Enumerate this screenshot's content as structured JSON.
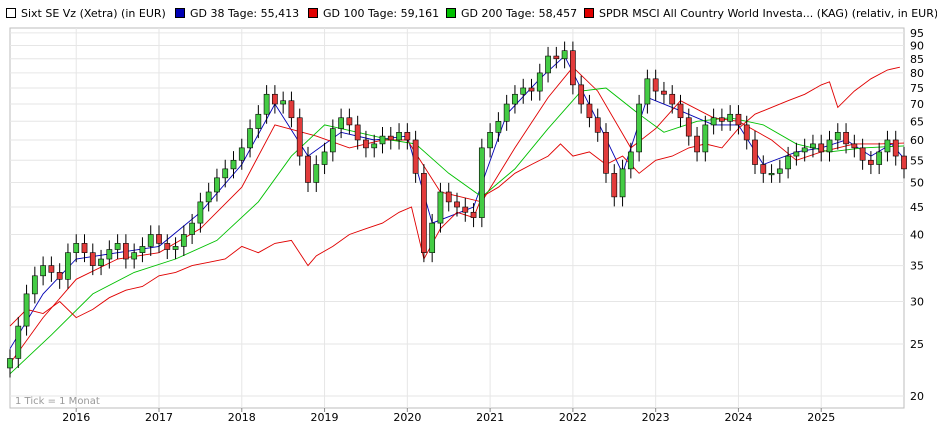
{
  "colors": {
    "ma38": "#0000b4",
    "ma100": "#e00000",
    "ma200": "#00c000",
    "benchmark": "#e00000",
    "candle_up": "#44cc44",
    "candle_down": "#e23b3b",
    "grid": "#e6e6e6"
  },
  "legend": [
    {
      "label": "Sixt SE Vz (Xetra) (in EUR)",
      "color": "#ffffff"
    },
    {
      "label": "GD 38 Tage: 55,413",
      "color": "#0000b4"
    },
    {
      "label": "GD 100 Tage: 59,161",
      "color": "#e00000"
    },
    {
      "label": "GD 200 Tage: 58,457",
      "color": "#00c000"
    },
    {
      "label": "SPDR MSCI All Country World Investa... (KAG) (relativ, in EUR)",
      "color": "#e00000"
    }
  ],
  "footnote": "1 Tick = 1 Monat",
  "chart_data": {
    "type": "candlestick",
    "y_scale": "log",
    "ylim": [
      19,
      97
    ],
    "y_ticks": [
      20,
      25,
      30,
      35,
      40,
      45,
      50,
      55,
      60,
      65,
      70,
      75,
      80,
      85,
      90,
      95
    ],
    "x_ticks": [
      "2016",
      "2017",
      "2018",
      "2019",
      "2020",
      "2021",
      "2022",
      "2023",
      "2024",
      "2025"
    ],
    "x_range": [
      "2015.2",
      "2026.0"
    ],
    "grid": true,
    "series": [
      {
        "name": "Sixt SE Vz (Xetra) (in EUR)",
        "kind": "close",
        "points": [
          [
            2015.2,
            23.5
          ],
          [
            2015.3,
            27
          ],
          [
            2015.4,
            31
          ],
          [
            2015.5,
            33.5
          ],
          [
            2015.6,
            35
          ],
          [
            2015.7,
            34
          ],
          [
            2015.8,
            33
          ],
          [
            2015.9,
            37
          ],
          [
            2016.0,
            38.5
          ],
          [
            2016.1,
            37
          ],
          [
            2016.2,
            35
          ],
          [
            2016.3,
            36
          ],
          [
            2016.4,
            37.5
          ],
          [
            2016.5,
            38.5
          ],
          [
            2016.6,
            36
          ],
          [
            2016.7,
            37
          ],
          [
            2016.8,
            38
          ],
          [
            2016.9,
            40
          ],
          [
            2017.0,
            38.5
          ],
          [
            2017.1,
            37.5
          ],
          [
            2017.2,
            38
          ],
          [
            2017.3,
            40
          ],
          [
            2017.4,
            42
          ],
          [
            2017.5,
            46
          ],
          [
            2017.6,
            48
          ],
          [
            2017.7,
            51
          ],
          [
            2017.8,
            53
          ],
          [
            2017.9,
            55
          ],
          [
            2018.0,
            58
          ],
          [
            2018.1,
            63
          ],
          [
            2018.2,
            67
          ],
          [
            2018.3,
            73
          ],
          [
            2018.4,
            70
          ],
          [
            2018.5,
            71
          ],
          [
            2018.6,
            66
          ],
          [
            2018.7,
            56
          ],
          [
            2018.8,
            50
          ],
          [
            2018.9,
            54
          ],
          [
            2019.0,
            57
          ],
          [
            2019.1,
            63
          ],
          [
            2019.2,
            66
          ],
          [
            2019.3,
            64
          ],
          [
            2019.4,
            60
          ],
          [
            2019.5,
            58
          ],
          [
            2019.6,
            59
          ],
          [
            2019.7,
            61
          ],
          [
            2019.8,
            60
          ],
          [
            2019.9,
            62
          ],
          [
            2020.0,
            60
          ],
          [
            2020.1,
            52
          ],
          [
            2020.2,
            37
          ],
          [
            2020.3,
            42
          ],
          [
            2020.4,
            48
          ],
          [
            2020.5,
            46
          ],
          [
            2020.6,
            45
          ],
          [
            2020.7,
            44
          ],
          [
            2020.8,
            43
          ],
          [
            2020.9,
            58
          ],
          [
            2021.0,
            62
          ],
          [
            2021.1,
            65
          ],
          [
            2021.2,
            70
          ],
          [
            2021.3,
            73
          ],
          [
            2021.4,
            75
          ],
          [
            2021.5,
            74
          ],
          [
            2021.6,
            80
          ],
          [
            2021.7,
            86
          ],
          [
            2021.8,
            85
          ],
          [
            2021.9,
            88
          ],
          [
            2022.0,
            76
          ],
          [
            2022.1,
            70
          ],
          [
            2022.2,
            66
          ],
          [
            2022.3,
            62
          ],
          [
            2022.4,
            52
          ],
          [
            2022.5,
            47
          ],
          [
            2022.6,
            53
          ],
          [
            2022.7,
            57
          ],
          [
            2022.8,
            70
          ],
          [
            2022.9,
            78
          ],
          [
            2023.0,
            74
          ],
          [
            2023.1,
            73
          ],
          [
            2023.2,
            70
          ],
          [
            2023.3,
            66
          ],
          [
            2023.4,
            61
          ],
          [
            2023.5,
            57
          ],
          [
            2023.6,
            64
          ],
          [
            2023.7,
            66
          ],
          [
            2023.8,
            65
          ],
          [
            2023.9,
            67
          ],
          [
            2024.0,
            64
          ],
          [
            2024.1,
            60
          ],
          [
            2024.2,
            54
          ],
          [
            2024.3,
            52
          ],
          [
            2024.4,
            52
          ],
          [
            2024.5,
            53
          ],
          [
            2024.6,
            56
          ],
          [
            2024.7,
            57
          ],
          [
            2024.8,
            58
          ],
          [
            2024.9,
            59
          ],
          [
            2025.0,
            57
          ],
          [
            2025.1,
            60
          ],
          [
            2025.2,
            62
          ],
          [
            2025.3,
            59
          ],
          [
            2025.4,
            58
          ],
          [
            2025.5,
            55
          ],
          [
            2025.6,
            54
          ],
          [
            2025.7,
            57
          ],
          [
            2025.8,
            60
          ],
          [
            2025.9,
            56
          ],
          [
            2026.0,
            53
          ]
        ]
      },
      {
        "name": "GD 38 Tage",
        "kind": "line",
        "color": "#0000b4",
        "points": [
          [
            2015.2,
            24.5
          ],
          [
            2015.6,
            31
          ],
          [
            2016.0,
            36
          ],
          [
            2016.5,
            37
          ],
          [
            2017.0,
            38
          ],
          [
            2017.5,
            44
          ],
          [
            2018.0,
            54
          ],
          [
            2018.4,
            70
          ],
          [
            2018.8,
            56
          ],
          [
            2019.2,
            62
          ],
          [
            2019.6,
            60
          ],
          [
            2020.0,
            61
          ],
          [
            2020.3,
            42
          ],
          [
            2020.8,
            45
          ],
          [
            2021.2,
            67
          ],
          [
            2021.6,
            78
          ],
          [
            2021.9,
            86
          ],
          [
            2022.3,
            65
          ],
          [
            2022.6,
            52
          ],
          [
            2022.9,
            72
          ],
          [
            2023.3,
            68
          ],
          [
            2023.7,
            64
          ],
          [
            2024.0,
            64
          ],
          [
            2024.3,
            54
          ],
          [
            2024.7,
            57
          ],
          [
            2025.0,
            58
          ],
          [
            2025.3,
            60
          ],
          [
            2025.6,
            56
          ],
          [
            2025.85,
            59
          ],
          [
            2026.0,
            55.4
          ]
        ]
      },
      {
        "name": "GD 100 Tage",
        "kind": "line",
        "color": "#e00000",
        "points": [
          [
            2015.2,
            23.0
          ],
          [
            2015.6,
            28
          ],
          [
            2016.0,
            33
          ],
          [
            2016.5,
            36
          ],
          [
            2017.0,
            37
          ],
          [
            2017.5,
            41
          ],
          [
            2018.0,
            49
          ],
          [
            2018.4,
            64
          ],
          [
            2018.9,
            61
          ],
          [
            2019.3,
            58
          ],
          [
            2019.7,
            60
          ],
          [
            2020.0,
            60
          ],
          [
            2020.4,
            48
          ],
          [
            2020.9,
            46
          ],
          [
            2021.3,
            58
          ],
          [
            2021.7,
            72
          ],
          [
            2022.0,
            82
          ],
          [
            2022.3,
            74
          ],
          [
            2022.7,
            58
          ],
          [
            2023.0,
            63
          ],
          [
            2023.3,
            71
          ],
          [
            2023.7,
            66
          ],
          [
            2024.0,
            65
          ],
          [
            2024.4,
            60
          ],
          [
            2024.7,
            55
          ],
          [
            2025.0,
            57
          ],
          [
            2025.4,
            59
          ],
          [
            2025.7,
            59
          ],
          [
            2026.0,
            59.2
          ]
        ]
      },
      {
        "name": "GD 200 Tage",
        "kind": "line",
        "color": "#00c000",
        "points": [
          [
            2015.2,
            22.0
          ],
          [
            2015.7,
            26
          ],
          [
            2016.2,
            31
          ],
          [
            2016.7,
            34
          ],
          [
            2017.2,
            36
          ],
          [
            2017.7,
            39
          ],
          [
            2018.2,
            46
          ],
          [
            2018.6,
            56
          ],
          [
            2019.0,
            64
          ],
          [
            2019.4,
            62
          ],
          [
            2019.8,
            60
          ],
          [
            2020.1,
            59
          ],
          [
            2020.5,
            52
          ],
          [
            2020.9,
            47
          ],
          [
            2021.3,
            53
          ],
          [
            2021.7,
            63
          ],
          [
            2022.1,
            74
          ],
          [
            2022.4,
            75
          ],
          [
            2022.8,
            67
          ],
          [
            2023.1,
            62
          ],
          [
            2023.5,
            65
          ],
          [
            2023.9,
            66
          ],
          [
            2024.3,
            64
          ],
          [
            2024.7,
            59
          ],
          [
            2025.1,
            57
          ],
          [
            2025.5,
            58
          ],
          [
            2026.0,
            58.5
          ]
        ]
      },
      {
        "name": "SPDR MSCI All Country World Investa... (KAG) (relativ, in EUR)",
        "kind": "line",
        "color": "#e00000",
        "points": [
          [
            2015.2,
            27
          ],
          [
            2015.4,
            29
          ],
          [
            2015.6,
            28.5
          ],
          [
            2015.8,
            30
          ],
          [
            2016.0,
            28
          ],
          [
            2016.2,
            29
          ],
          [
            2016.4,
            30.5
          ],
          [
            2016.6,
            31.5
          ],
          [
            2016.8,
            32
          ],
          [
            2017.0,
            33.5
          ],
          [
            2017.2,
            34
          ],
          [
            2017.4,
            35
          ],
          [
            2017.6,
            35.5
          ],
          [
            2017.8,
            36
          ],
          [
            2018.0,
            38
          ],
          [
            2018.2,
            37
          ],
          [
            2018.4,
            38.5
          ],
          [
            2018.6,
            39
          ],
          [
            2018.8,
            35
          ],
          [
            2018.9,
            36.5
          ],
          [
            2019.1,
            38
          ],
          [
            2019.3,
            40
          ],
          [
            2019.5,
            41
          ],
          [
            2019.7,
            42
          ],
          [
            2019.9,
            44
          ],
          [
            2020.05,
            45
          ],
          [
            2020.2,
            36
          ],
          [
            2020.4,
            41
          ],
          [
            2020.6,
            44
          ],
          [
            2020.8,
            43
          ],
          [
            2020.9,
            47
          ],
          [
            2021.1,
            49
          ],
          [
            2021.3,
            52
          ],
          [
            2021.5,
            54
          ],
          [
            2021.7,
            56
          ],
          [
            2021.85,
            59
          ],
          [
            2022.0,
            56
          ],
          [
            2022.2,
            57
          ],
          [
            2022.4,
            54
          ],
          [
            2022.6,
            56
          ],
          [
            2022.8,
            52
          ],
          [
            2023.0,
            55
          ],
          [
            2023.2,
            56
          ],
          [
            2023.4,
            58
          ],
          [
            2023.6,
            59
          ],
          [
            2023.8,
            58
          ],
          [
            2024.0,
            63
          ],
          [
            2024.2,
            67
          ],
          [
            2024.4,
            69
          ],
          [
            2024.6,
            71
          ],
          [
            2024.8,
            73
          ],
          [
            2025.0,
            76
          ],
          [
            2025.1,
            77
          ],
          [
            2025.2,
            69
          ],
          [
            2025.4,
            74
          ],
          [
            2025.6,
            78
          ],
          [
            2025.8,
            81
          ],
          [
            2025.95,
            82
          ]
        ]
      }
    ]
  }
}
